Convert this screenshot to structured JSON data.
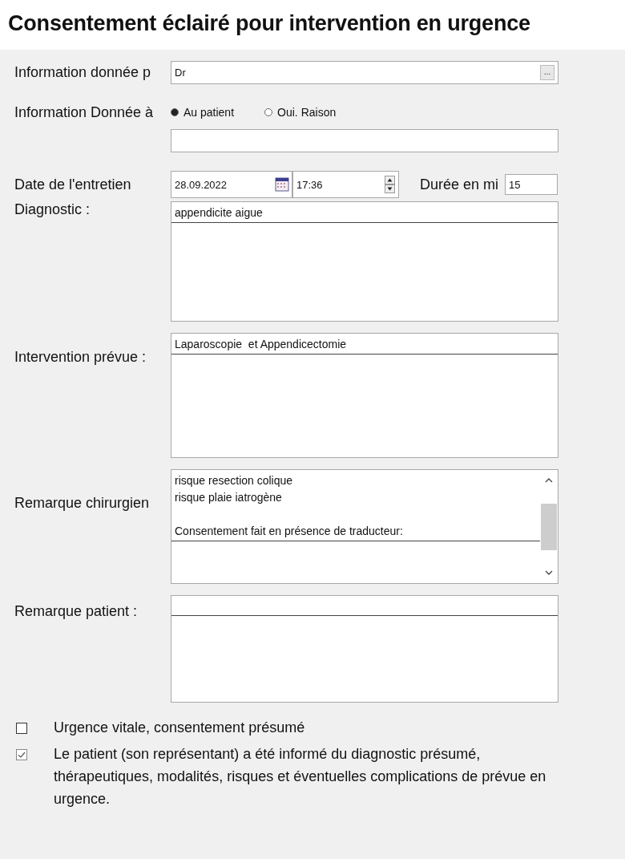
{
  "title": "Consentement éclairé pour intervention en urgence",
  "informed_by": {
    "label": "Information donnée p",
    "value": "Dr",
    "button": "..."
  },
  "informed_to": {
    "label": "Information Donnée à",
    "options": [
      {
        "label": "Au patient",
        "selected": true
      },
      {
        "label": "Oui. Raison",
        "selected": false
      }
    ]
  },
  "interview": {
    "label": "Date de l'entretien",
    "date": "28.09.2022",
    "time": "17:36",
    "duration_label": "Durée en mi",
    "duration": "15"
  },
  "text_areas": [
    {
      "label": "Diagnostic :",
      "paragraphs": [
        [
          "appendicite aigue"
        ]
      ],
      "kind": "plain"
    },
    {
      "label": "Intervention prévue :",
      "paragraphs": [
        [
          "Laparoscopie  et Appendicectomie"
        ]
      ],
      "kind": "plain"
    },
    {
      "label": "Remarque chirurgien",
      "paragraphs": [
        [
          "risque resection colique",
          "risque plaie iatrogène"
        ],
        [
          "Consentement fait en présence de traducteur:"
        ]
      ],
      "kind": "scroll"
    },
    {
      "label": "Remarque patient :",
      "kind": "plain"
    }
  ],
  "checks": [
    {
      "label": "Urgence vitale, consentement présumé",
      "checked": false
    },
    {
      "label": "Le patient (son représentant) a été informé du diagnostic présumé, thérapeutiques, modalités, risques et éventuelles complications de prévue en urgence.",
      "checked": true
    }
  ]
}
